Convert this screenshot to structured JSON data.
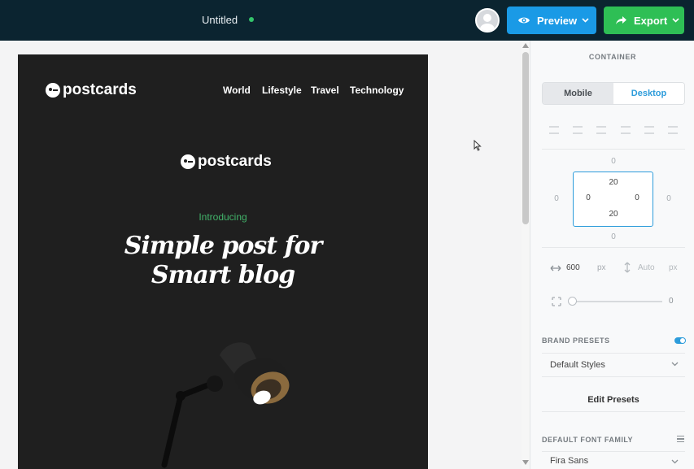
{
  "header": {
    "doc_title": "Untitled",
    "preview_label": "Preview",
    "export_label": "Export",
    "status_color": "#33c46b"
  },
  "email": {
    "logo_text": "postcards",
    "nav": [
      "World",
      "Lifestyle",
      "Travel",
      "Technology"
    ],
    "intro": "Introducing",
    "headline_line1": "Simple post for",
    "headline_line2": "Smart blog"
  },
  "panel": {
    "title": "CONTAINER",
    "tabs": {
      "mobile": "Mobile",
      "desktop": "Desktop",
      "active": "Desktop"
    },
    "margin": {
      "top": "0",
      "right": "0",
      "bottom": "0",
      "left": "0"
    },
    "padding": {
      "top": "20",
      "right": "0",
      "bottom": "20",
      "left": "0"
    },
    "width": {
      "value": "600",
      "unit": "px"
    },
    "height": {
      "value": "Auto",
      "unit": "px"
    },
    "border_radius": "0",
    "brand_presets_label": "BRAND PRESETS",
    "brand_presets_enabled": true,
    "preset_value": "Default Styles",
    "edit_presets_label": "Edit Presets",
    "font_family_label": "DEFAULT FONT FAMILY",
    "font_family_value": "Fira Sans"
  },
  "colors": {
    "topbar": "#0b2430",
    "preview": "#1a9ae6",
    "export": "#2ebf55",
    "accent": "#2d9cdb",
    "intro_green": "#42b36a"
  }
}
